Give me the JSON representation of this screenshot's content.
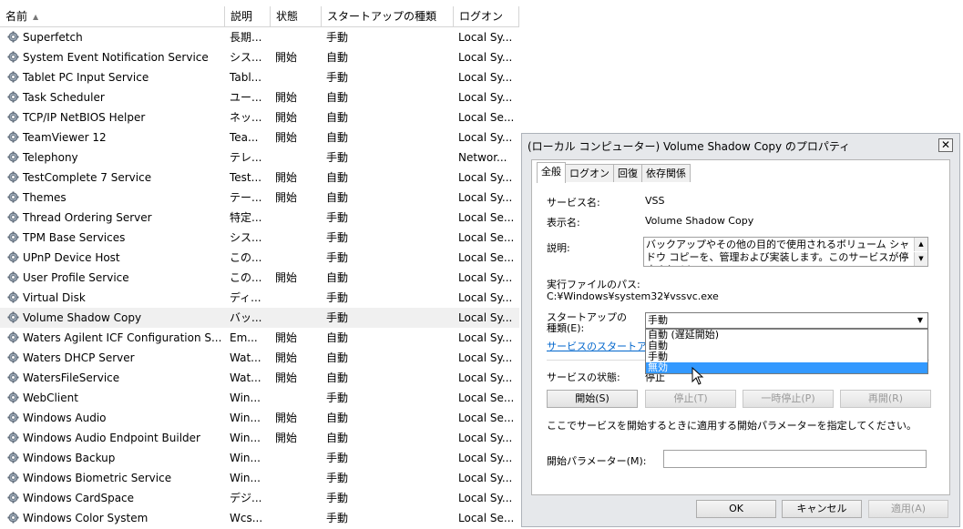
{
  "columns": [
    {
      "label": "名前",
      "width": 247
    },
    {
      "label": "説明",
      "width": 50
    },
    {
      "label": "状態",
      "width": 56
    },
    {
      "label": "スタートアップの種類",
      "width": 145
    },
    {
      "label": "ログオン",
      "width": 72
    }
  ],
  "services": [
    {
      "name": "Superfetch",
      "desc": "長期...",
      "state": "",
      "startup": "手動",
      "logon": "Local Sy..."
    },
    {
      "name": "System Event Notification Service",
      "desc": "シス...",
      "state": "開始",
      "startup": "自動",
      "logon": "Local Sy..."
    },
    {
      "name": "Tablet PC Input Service",
      "desc": "Tabl...",
      "state": "",
      "startup": "手動",
      "logon": "Local Sy..."
    },
    {
      "name": "Task Scheduler",
      "desc": "ユー...",
      "state": "開始",
      "startup": "自動",
      "logon": "Local Sy..."
    },
    {
      "name": "TCP/IP NetBIOS Helper",
      "desc": "ネッ...",
      "state": "開始",
      "startup": "自動",
      "logon": "Local Se..."
    },
    {
      "name": "TeamViewer 12",
      "desc": "Tea...",
      "state": "開始",
      "startup": "自動",
      "logon": "Local Sy..."
    },
    {
      "name": "Telephony",
      "desc": "テレ...",
      "state": "",
      "startup": "手動",
      "logon": "Networ..."
    },
    {
      "name": "TestComplete 7 Service",
      "desc": "Test...",
      "state": "開始",
      "startup": "自動",
      "logon": "Local Sy..."
    },
    {
      "name": "Themes",
      "desc": "テー...",
      "state": "開始",
      "startup": "自動",
      "logon": "Local Sy..."
    },
    {
      "name": "Thread Ordering Server",
      "desc": "特定...",
      "state": "",
      "startup": "手動",
      "logon": "Local Se..."
    },
    {
      "name": "TPM Base Services",
      "desc": "シス...",
      "state": "",
      "startup": "手動",
      "logon": "Local Se..."
    },
    {
      "name": "UPnP Device Host",
      "desc": "この...",
      "state": "",
      "startup": "手動",
      "logon": "Local Se..."
    },
    {
      "name": "User Profile Service",
      "desc": "この...",
      "state": "開始",
      "startup": "自動",
      "logon": "Local Sy..."
    },
    {
      "name": "Virtual Disk",
      "desc": "ディ...",
      "state": "",
      "startup": "手動",
      "logon": "Local Sy..."
    },
    {
      "name": "Volume Shadow Copy",
      "desc": "バッ...",
      "state": "",
      "startup": "手動",
      "logon": "Local Sy...",
      "selected": true
    },
    {
      "name": "Waters Agilent ICF Configuration S...",
      "desc": "Em...",
      "state": "開始",
      "startup": "自動",
      "logon": "Local Sy..."
    },
    {
      "name": "Waters DHCP Server",
      "desc": "Wat...",
      "state": "開始",
      "startup": "自動",
      "logon": "Local Sy..."
    },
    {
      "name": "WatersFileService",
      "desc": "Wat...",
      "state": "開始",
      "startup": "自動",
      "logon": "Local Sy..."
    },
    {
      "name": "WebClient",
      "desc": "Win...",
      "state": "",
      "startup": "手動",
      "logon": "Local Se..."
    },
    {
      "name": "Windows Audio",
      "desc": "Win...",
      "state": "開始",
      "startup": "自動",
      "logon": "Local Se..."
    },
    {
      "name": "Windows Audio Endpoint Builder",
      "desc": "Win...",
      "state": "開始",
      "startup": "自動",
      "logon": "Local Sy..."
    },
    {
      "name": "Windows Backup",
      "desc": "Win...",
      "state": "",
      "startup": "手動",
      "logon": "Local Sy..."
    },
    {
      "name": "Windows Biometric Service",
      "desc": "Win...",
      "state": "",
      "startup": "手動",
      "logon": "Local Sy..."
    },
    {
      "name": "Windows CardSpace",
      "desc": "デジ...",
      "state": "",
      "startup": "手動",
      "logon": "Local Sy..."
    },
    {
      "name": "Windows Color System",
      "desc": "Wcs...",
      "state": "",
      "startup": "手動",
      "logon": "Local Se..."
    }
  ],
  "dialog": {
    "title": "(ローカル コンピューター) Volume Shadow Copy のプロパティ",
    "close": "✕",
    "tabs": [
      "全般",
      "ログオン",
      "回復",
      "依存関係"
    ],
    "service_name_label": "サービス名:",
    "service_name": "VSS",
    "display_name_label": "表示名:",
    "display_name": "Volume Shadow Copy",
    "description_label": "説明:",
    "description": "バックアップやその他の目的で使用されるボリューム シャドウ コピーを、管理および実装します。このサービスが停止されると、シャ",
    "exe_path_label": "実行ファイルのパス:",
    "exe_path": "C:¥Windows¥system32¥vssvc.exe",
    "startup_label_1": "スタートアップの",
    "startup_label_2": "種類(E):",
    "startup_value": "手動",
    "startup_options": [
      "自動 (遅延開始)",
      "自動",
      "手動",
      "無効"
    ],
    "highlighted_option": 3,
    "startup_link": "サービスのスタートアップ",
    "status_label": "サービスの状態:",
    "status_value": "停止",
    "btn_start": "開始(S)",
    "btn_stop": "停止(T)",
    "btn_pause": "一時停止(P)",
    "btn_resume": "再開(R)",
    "param_hint": "ここでサービスを開始するときに適用する開始パラメーターを指定してください。",
    "param_label": "開始パラメーター(M):",
    "param_value": "",
    "btn_ok": "OK",
    "btn_cancel": "キャンセル",
    "btn_apply": "適用(A)"
  }
}
